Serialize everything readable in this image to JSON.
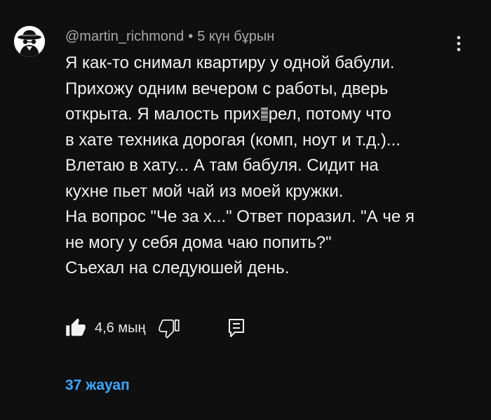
{
  "comment": {
    "author": "@martin_richmond",
    "separator": "•",
    "time": "5 күн бұрын",
    "avatar_icon": "incognito-hat-avatar",
    "text_lines": [
      "Я как-то снимал квартиру у одной бабули.",
      "Прихожу одним вечером с работы, дверь",
      "открыта. Я малость прих",
      "рел, потому что",
      "в хате техника дорогая (комп, ноут и т.д.)...",
      "Влетаю в хату... А там бабуля. Сидит на",
      "кухне пьет мой чай из моей кружки.",
      "На вопрос \"Че за х...\" Ответ поразил. \"А че я",
      "не могу у себя дома чаю попить?\"",
      "Съехал на следуюшей день."
    ],
    "likes": "4,6 мың",
    "replies": "37 жауап"
  },
  "icons": {
    "more": "more-vert-icon",
    "like": "thumbs-up-icon",
    "dislike": "thumbs-down-icon",
    "reply": "comment-reply-icon"
  },
  "colors": {
    "background": "#0f0f0f",
    "text": "#f1f1f1",
    "meta": "#aaaaaa",
    "link": "#3ea6ff"
  }
}
